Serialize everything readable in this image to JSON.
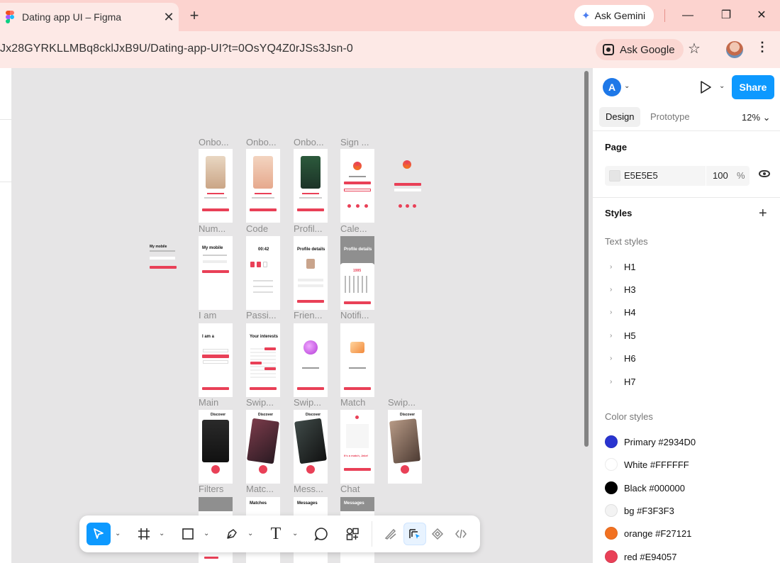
{
  "browser": {
    "tab_title": "Dating app UI – Figma",
    "tab_close": "✕",
    "new_tab": "+",
    "gemini_label": "Ask Gemini",
    "url": "Jx28GYRKLLMBq8cklJxB9U/Dating-app-UI?t=0OsYQ4Z0rJSs3Jsn-0",
    "ask_google_label": "Ask Google",
    "window_controls": [
      "—",
      "❐",
      "✕"
    ]
  },
  "canvas": {
    "background": "#E6E5E6",
    "frame_labels": [
      "Onbo...",
      "Onbo...",
      "Onbo...",
      "Sign ...",
      "Num...",
      "Code",
      "Profil...",
      "Cale...",
      "I am",
      "Passi...",
      "Frien...",
      "Notifi...",
      "Main",
      "Swip...",
      "Swip...",
      "Match",
      "Swip...",
      "Filters",
      "Matc...",
      "Mess...",
      "Chat"
    ],
    "frame_titles": {
      "my_mobile": "My mobile",
      "code_timer": "00:42",
      "profile_details": "Profile details",
      "i_am": "I am a",
      "your_interests": "Your interests",
      "discover": "Discover",
      "matches": "Matches",
      "messages": "Messages",
      "match_text": "It's a match, Jake!",
      "year": "1995"
    }
  },
  "toolbar": {
    "tools": [
      "move",
      "frame",
      "rectangle",
      "pen",
      "text",
      "comment",
      "actions",
      "draw",
      "design",
      "prototype",
      "dev"
    ]
  },
  "help_label": "?",
  "panel": {
    "avatar_letter": "A",
    "share_label": "Share",
    "tab_design": "Design",
    "tab_prototype": "Prototype",
    "zoom": "12%",
    "page_section": "Page",
    "page_color": "E5E5E5",
    "page_opacity": "100",
    "page_opacity_unit": "%",
    "styles_section": "Styles",
    "text_styles_label": "Text styles",
    "text_styles": [
      "H1",
      "H3",
      "H4",
      "H5",
      "H6",
      "H7"
    ],
    "color_styles_label": "Color styles",
    "color_styles": [
      {
        "label": "Primary #2934D0",
        "color": "#2934D0"
      },
      {
        "label": "White #FFFFFF",
        "color": "#FFFFFF"
      },
      {
        "label": "Black #000000",
        "color": "#000000"
      },
      {
        "label": "bg #F3F3F3",
        "color": "#F3F3F3"
      },
      {
        "label": "orange #F27121",
        "color": "#F27121"
      },
      {
        "label": "red #E94057",
        "color": "#E94057"
      }
    ]
  }
}
